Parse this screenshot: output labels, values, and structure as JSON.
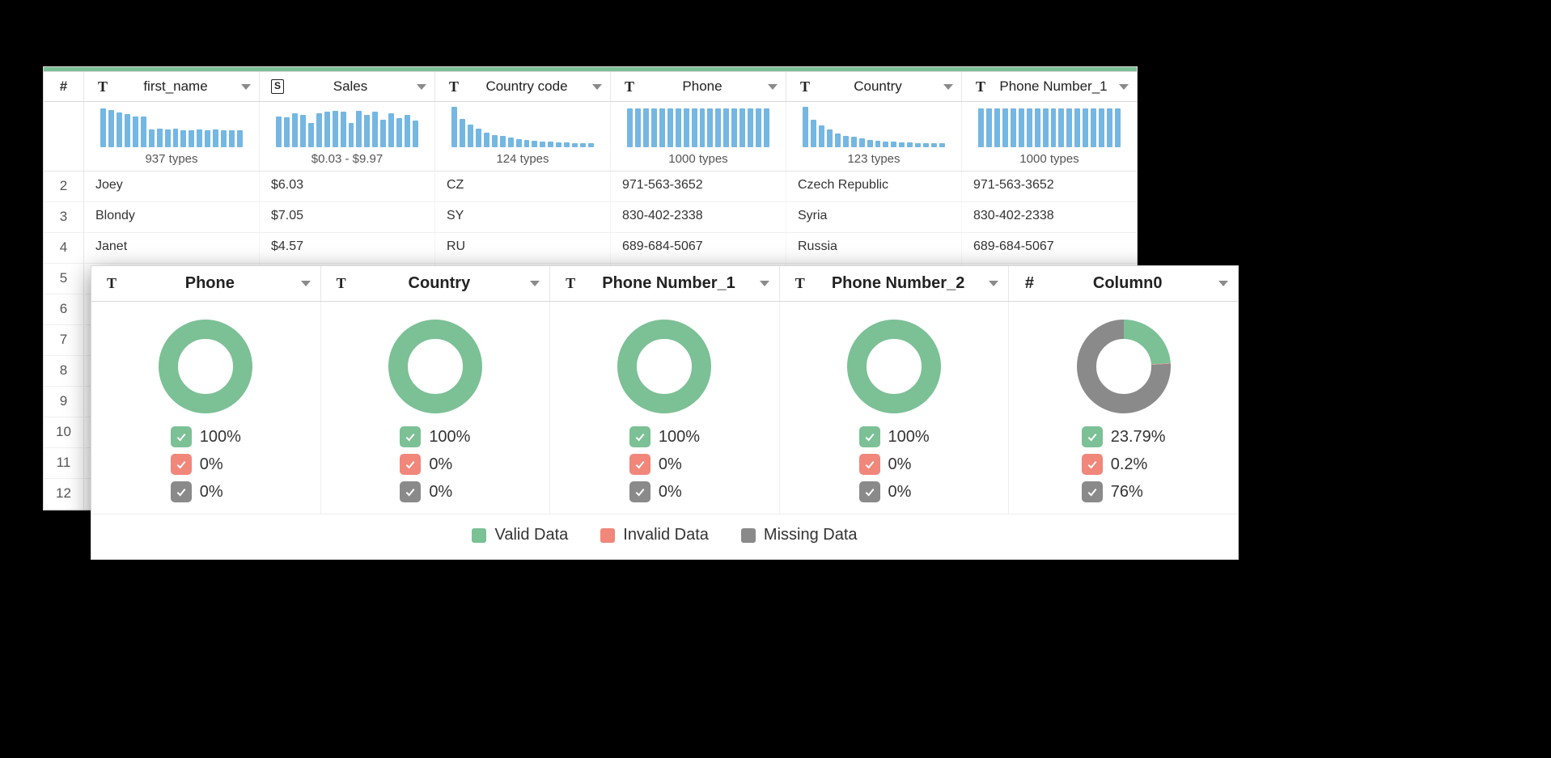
{
  "colors": {
    "valid": "#7cc096",
    "invalid": "#f1867a",
    "missing": "#8a8a8a",
    "bar": "#74b7e3"
  },
  "back": {
    "rownum_header": "#",
    "columns": [
      {
        "type": "text",
        "label": "first_name",
        "summary": "937 types",
        "bars": [
          48,
          46,
          43,
          41,
          38,
          38,
          22,
          23,
          22,
          23,
          21,
          21,
          22,
          21,
          22,
          21,
          21,
          21
        ]
      },
      {
        "type": "dollar",
        "label": "Sales",
        "summary": "$0.03 - $9.97",
        "bars": [
          38,
          37,
          42,
          40,
          30,
          42,
          44,
          45,
          44,
          30,
          45,
          40,
          44,
          34,
          42,
          36,
          40,
          33
        ]
      },
      {
        "type": "text",
        "label": "Country code",
        "summary": "124 types",
        "bars": [
          50,
          35,
          28,
          23,
          18,
          15,
          14,
          12,
          10,
          9,
          8,
          7,
          7,
          6,
          6,
          5,
          5,
          5
        ]
      },
      {
        "type": "text",
        "label": "Phone",
        "summary": "1000 types",
        "bars": [
          48,
          48,
          48,
          48,
          48,
          48,
          48,
          48,
          48,
          48,
          48,
          48,
          48,
          48,
          48,
          48,
          48,
          48
        ]
      },
      {
        "type": "text",
        "label": "Country",
        "summary": "123 types",
        "bars": [
          50,
          34,
          27,
          22,
          17,
          14,
          13,
          11,
          9,
          8,
          7,
          7,
          6,
          6,
          5,
          5,
          5,
          5
        ]
      },
      {
        "type": "text",
        "label": "Phone Number_1",
        "summary": "1000 types",
        "bars": [
          48,
          48,
          48,
          48,
          48,
          48,
          48,
          48,
          48,
          48,
          48,
          48,
          48,
          48,
          48,
          48,
          48,
          48
        ]
      }
    ],
    "rows": [
      {
        "n": "2",
        "cells": [
          "Joey",
          "$6.03",
          "CZ",
          "971-563-3652",
          "Czech Republic",
          "971-563-3652"
        ]
      },
      {
        "n": "3",
        "cells": [
          "Blondy",
          "$7.05",
          "SY",
          "830-402-2338",
          "Syria",
          "830-402-2338"
        ]
      },
      {
        "n": "4",
        "cells": [
          "Janet",
          "$4.57",
          "RU",
          "689-684-5067",
          "Russia",
          "689-684-5067"
        ]
      },
      {
        "n": "5",
        "cells": [
          "",
          "",
          "",
          "",
          "",
          ""
        ]
      },
      {
        "n": "6",
        "cells": [
          "",
          "",
          "",
          "",
          "",
          ""
        ]
      },
      {
        "n": "7",
        "cells": [
          "",
          "",
          "",
          "",
          "",
          ""
        ]
      },
      {
        "n": "8",
        "cells": [
          "",
          "",
          "",
          "",
          "",
          ""
        ]
      },
      {
        "n": "9",
        "cells": [
          "",
          "",
          "",
          "",
          "",
          ""
        ]
      },
      {
        "n": "10",
        "cells": [
          "",
          "",
          "",
          "",
          "",
          ""
        ]
      },
      {
        "n": "11",
        "cells": [
          "",
          "",
          "",
          "",
          "",
          ""
        ]
      },
      {
        "n": "12",
        "cells": [
          "",
          "",
          "",
          "",
          "",
          ""
        ]
      }
    ]
  },
  "front": {
    "columns": [
      {
        "type": "text",
        "label": "Phone",
        "stats": {
          "valid": "100%",
          "invalid": "0%",
          "missing": "0%"
        },
        "donut": {
          "valid": 100,
          "invalid": 0,
          "missing": 0
        }
      },
      {
        "type": "text",
        "label": "Country",
        "stats": {
          "valid": "100%",
          "invalid": "0%",
          "missing": "0%"
        },
        "donut": {
          "valid": 100,
          "invalid": 0,
          "missing": 0
        }
      },
      {
        "type": "text",
        "label": "Phone Number_1",
        "stats": {
          "valid": "100%",
          "invalid": "0%",
          "missing": "0%"
        },
        "donut": {
          "valid": 100,
          "invalid": 0,
          "missing": 0
        }
      },
      {
        "type": "text",
        "label": "Phone Number_2",
        "stats": {
          "valid": "100%",
          "invalid": "0%",
          "missing": "0%"
        },
        "donut": {
          "valid": 100,
          "invalid": 0,
          "missing": 0
        }
      },
      {
        "type": "number",
        "label": "Column0",
        "stats": {
          "valid": "23.79%",
          "invalid": "0.2%",
          "missing": "76%"
        },
        "donut": {
          "valid": 23.79,
          "invalid": 0.2,
          "missing": 76
        }
      }
    ],
    "legend": {
      "valid": "Valid Data",
      "invalid": "Invalid Data",
      "missing": "Missing Data"
    }
  },
  "chart_data": [
    {
      "type": "bar",
      "title": "first_name distribution",
      "note": "937 types",
      "values": [
        48,
        46,
        43,
        41,
        38,
        38,
        22,
        23,
        22,
        23,
        21,
        21,
        22,
        21,
        22,
        21,
        21,
        21
      ]
    },
    {
      "type": "bar",
      "title": "Sales distribution",
      "note": "$0.03 - $9.97",
      "values": [
        38,
        37,
        42,
        40,
        30,
        42,
        44,
        45,
        44,
        30,
        45,
        40,
        44,
        34,
        42,
        36,
        40,
        33
      ]
    },
    {
      "type": "bar",
      "title": "Country code distribution",
      "note": "124 types",
      "values": [
        50,
        35,
        28,
        23,
        18,
        15,
        14,
        12,
        10,
        9,
        8,
        7,
        7,
        6,
        6,
        5,
        5,
        5
      ]
    },
    {
      "type": "bar",
      "title": "Phone distribution",
      "note": "1000 types",
      "values": [
        48,
        48,
        48,
        48,
        48,
        48,
        48,
        48,
        48,
        48,
        48,
        48,
        48,
        48,
        48,
        48,
        48,
        48
      ]
    },
    {
      "type": "bar",
      "title": "Country distribution",
      "note": "123 types",
      "values": [
        50,
        34,
        27,
        22,
        17,
        14,
        13,
        11,
        9,
        8,
        7,
        7,
        6,
        6,
        5,
        5,
        5,
        5
      ]
    },
    {
      "type": "bar",
      "title": "Phone Number_1 distribution",
      "note": "1000 types",
      "values": [
        48,
        48,
        48,
        48,
        48,
        48,
        48,
        48,
        48,
        48,
        48,
        48,
        48,
        48,
        48,
        48,
        48,
        48
      ]
    },
    {
      "type": "pie",
      "title": "Phone quality",
      "series": [
        {
          "name": "Valid",
          "value": 100
        },
        {
          "name": "Invalid",
          "value": 0
        },
        {
          "name": "Missing",
          "value": 0
        }
      ]
    },
    {
      "type": "pie",
      "title": "Country quality",
      "series": [
        {
          "name": "Valid",
          "value": 100
        },
        {
          "name": "Invalid",
          "value": 0
        },
        {
          "name": "Missing",
          "value": 0
        }
      ]
    },
    {
      "type": "pie",
      "title": "Phone Number_1 quality",
      "series": [
        {
          "name": "Valid",
          "value": 100
        },
        {
          "name": "Invalid",
          "value": 0
        },
        {
          "name": "Missing",
          "value": 0
        }
      ]
    },
    {
      "type": "pie",
      "title": "Phone Number_2 quality",
      "series": [
        {
          "name": "Valid",
          "value": 100
        },
        {
          "name": "Invalid",
          "value": 0
        },
        {
          "name": "Missing",
          "value": 0
        }
      ]
    },
    {
      "type": "pie",
      "title": "Column0 quality",
      "series": [
        {
          "name": "Valid",
          "value": 23.79
        },
        {
          "name": "Invalid",
          "value": 0.2
        },
        {
          "name": "Missing",
          "value": 76
        }
      ]
    }
  ]
}
